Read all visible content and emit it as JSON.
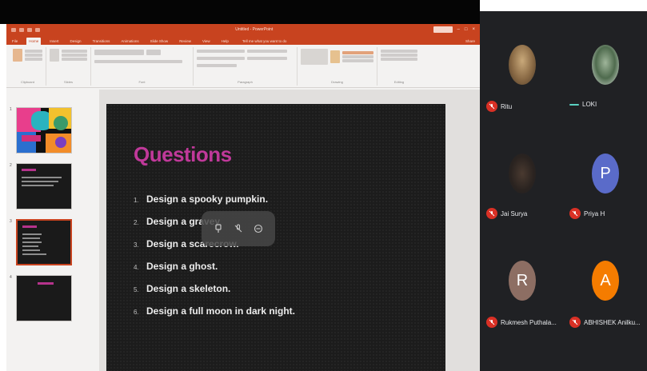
{
  "app": {
    "title": "Untitled - PowerPoint",
    "tabs": [
      "File",
      "Home",
      "Insert",
      "Design",
      "Transitions",
      "Animations",
      "Slide Show",
      "Review",
      "View",
      "Help"
    ],
    "active_tab": "Home",
    "tell_me": "Tell me what you want to do",
    "share": "Share"
  },
  "ribbon_groups": [
    "Clipboard",
    "Slides",
    "Font",
    "Paragraph",
    "Drawing",
    "Editing"
  ],
  "thumbnails": [
    {
      "num": "1"
    },
    {
      "num": "2"
    },
    {
      "num": "3"
    },
    {
      "num": "4"
    }
  ],
  "slide": {
    "title": "Questions",
    "items": [
      {
        "num": "1.",
        "text": "Design a spooky pumpkin."
      },
      {
        "num": "2.",
        "text": "Design a gravey"
      },
      {
        "num": "3.",
        "text": "Design a scarecrow."
      },
      {
        "num": "4.",
        "text": "Design a ghost."
      },
      {
        "num": "5.",
        "text": "Design a skeleton."
      },
      {
        "num": "6.",
        "text": "Design a full moon in dark night."
      }
    ]
  },
  "participants": [
    {
      "name": "Ritu",
      "initial": "",
      "muted": true,
      "avatar_type": "photo1",
      "color": "#8a6a45"
    },
    {
      "name": "LOKI",
      "initial": "",
      "muted": false,
      "avatar_type": "photo2",
      "color": "#4f6b4e"
    },
    {
      "name": "Jai Surya",
      "initial": "",
      "muted": true,
      "avatar_type": "photo3",
      "color": "#2a2320"
    },
    {
      "name": "Priya H",
      "initial": "P",
      "muted": true,
      "avatar_type": "initial",
      "color": "#5a6bc9"
    },
    {
      "name": "Rukmesh Puthala...",
      "initial": "R",
      "muted": true,
      "avatar_type": "initial",
      "color": "#8d6e63"
    },
    {
      "name": "ABHISHEK Anilku...",
      "initial": "A",
      "muted": true,
      "avatar_type": "initial",
      "color": "#f57c00"
    }
  ],
  "colors": {
    "ppt_accent": "#c8431f",
    "slide_title": "#c0399a",
    "mute_red": "#d93025",
    "panel_bg": "#202124"
  }
}
